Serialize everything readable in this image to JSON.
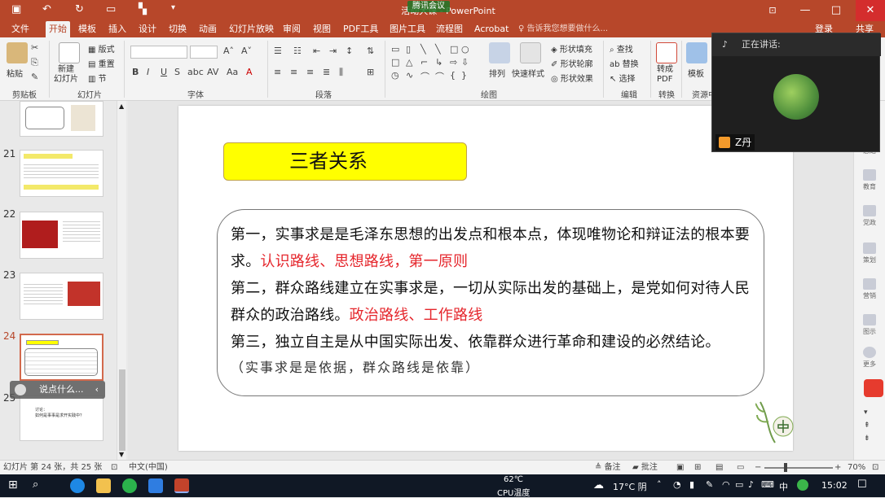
{
  "titlebar": {
    "title": "活动大课 - PowerPoint",
    "meeting_label": "腾讯会议",
    "restore_label": "□",
    "min_label": "—",
    "close_label": "✕"
  },
  "tabs": [
    {
      "label": "文件",
      "x": 0
    },
    {
      "label": "开始",
      "x": 0
    },
    {
      "label": "模板",
      "x": 0
    },
    {
      "label": "插入",
      "x": 0
    },
    {
      "label": "设计",
      "x": 0
    },
    {
      "label": "切换",
      "x": 0
    },
    {
      "label": "动画",
      "x": 0
    },
    {
      "label": "幻灯片放映",
      "x": 0
    },
    {
      "label": "审阅",
      "x": 0
    },
    {
      "label": "视图",
      "x": 0
    },
    {
      "label": "PDF工具",
      "x": 0
    },
    {
      "label": "图片工具",
      "x": 0
    },
    {
      "label": "流程图",
      "x": 0
    },
    {
      "label": "Acrobat",
      "x": 0
    }
  ],
  "tell_me": "告诉我您想要做什么...",
  "login": "登录",
  "share": "共享",
  "ribbon": {
    "paste": "粘贴",
    "new_slide": "新建\n幻灯片",
    "layout": "版式",
    "reset": "重置",
    "section": "节",
    "arrange": "排列",
    "quick_styles": "快速样式",
    "shape_fill": "形状填充",
    "shape_outline": "形状轮廓",
    "shape_effect": "形状效果",
    "find": "查找",
    "replace": "替换",
    "select": "选择",
    "convert_pdf": "转成\nPDF",
    "template": "模板",
    "groups": {
      "clipboard": "剪贴板",
      "slides": "幻灯片",
      "font": "字体",
      "paragraph": "段落",
      "drawing": "绘图",
      "editing": "编辑",
      "convert": "转换",
      "resource": "资源中"
    }
  },
  "thumbs": [
    {
      "num": "21"
    },
    {
      "num": "22"
    },
    {
      "num": "23"
    },
    {
      "num": "24"
    },
    {
      "num": "25"
    }
  ],
  "thumb25_text": "讨论：\n如何是事事是求开实践中？",
  "say_bar": "说点什么...",
  "slide": {
    "title": "三者关系",
    "p1_main": "第一，实事求是是毛泽东思想的出发点和根本点，体现唯物论和辩证法的根本要求。",
    "p1_red": "认识路线、思想路线，第一原则",
    "p2_main": "第二，群众路线建立在实事求是，一切从实际出发的基础上，是党如何对待人民群众的政治路线。",
    "p2_red": "政治路线、工作路线",
    "p3": "第三，独立自主是从中国实际出发、依靠群众进行革命和建设的必然结论。",
    "note": "（实事求是是依据，群众路线是依靠）"
  },
  "meeting": {
    "speaking": "正在讲话:",
    "name": "Z丹"
  },
  "side": [
    {
      "label": "总结"
    },
    {
      "label": "教育"
    },
    {
      "label": "党政"
    },
    {
      "label": "策划"
    },
    {
      "label": "营销"
    },
    {
      "label": "图示"
    },
    {
      "label": "更多"
    }
  ],
  "status": {
    "slide_info": "幻灯片 第 24 张，共 25 张",
    "language": "中文(中国)",
    "notes": "备注",
    "comments": "批注",
    "zoom": "70%"
  },
  "taskbar": {
    "cpu_temp": "62℃",
    "cpu_label": "CPU温度",
    "weather": "17°C 阴",
    "ime": "中",
    "time": "15:02"
  },
  "colors": {
    "brand": "#b7472a",
    "title_fill": "#ffff00",
    "highlight_red": "#e5262c"
  }
}
